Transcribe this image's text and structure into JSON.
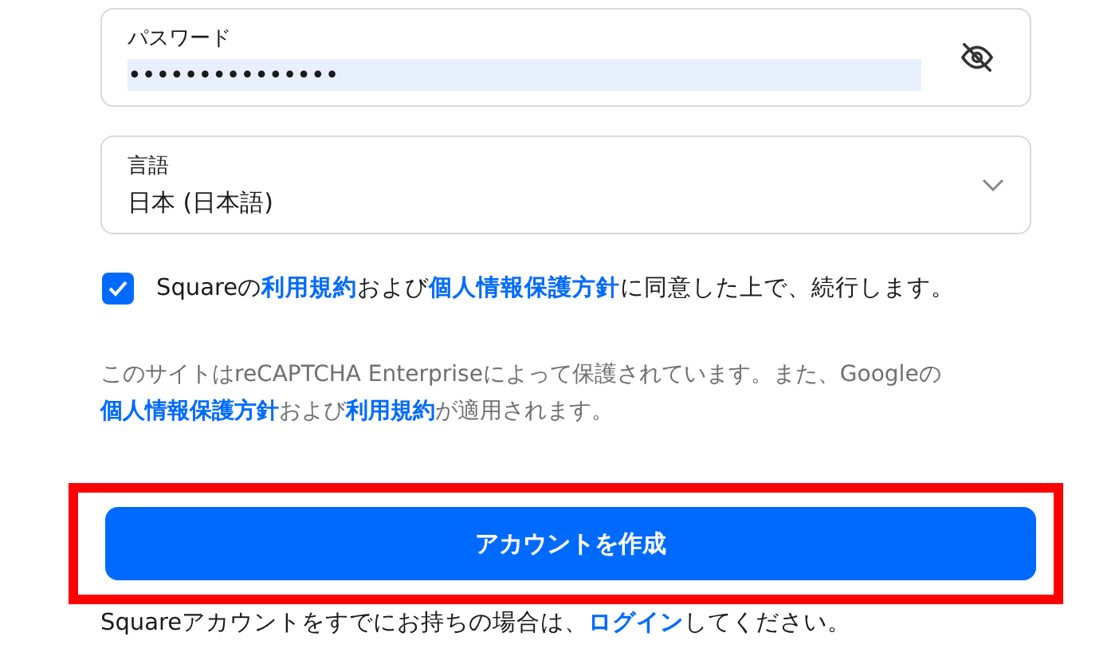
{
  "password": {
    "label": "パスワード",
    "value": "•••••••••••••••",
    "autofilled": true
  },
  "language": {
    "label": "言語",
    "value": "日本 (日本語)"
  },
  "consent": {
    "checked": true,
    "parts": [
      {
        "kind": "text",
        "text": "Squareの"
      },
      {
        "kind": "link",
        "text": "利用規約"
      },
      {
        "kind": "text",
        "text": "および"
      },
      {
        "kind": "link",
        "text": "個人情報保護方針"
      },
      {
        "kind": "text",
        "text": "に同意した上で、続行します。"
      }
    ]
  },
  "recaptcha": {
    "parts": [
      {
        "kind": "text",
        "text": "このサイトはreCAPTCHA Enterpriseによって保護されています。また、Googleの"
      },
      {
        "kind": "link",
        "text": "個人情報保護方針"
      },
      {
        "kind": "text",
        "text": "および"
      },
      {
        "kind": "link",
        "text": "利用規約"
      },
      {
        "kind": "text",
        "text": "が適用されます。"
      }
    ]
  },
  "create_button": {
    "label": "アカウントを作成",
    "highlighted": true
  },
  "signin": {
    "parts": [
      {
        "kind": "text",
        "text": "Squareアカウントをすでにお持ちの場合は、"
      },
      {
        "kind": "link",
        "text": "ログイン"
      },
      {
        "kind": "text",
        "text": "してください。"
      }
    ]
  }
}
